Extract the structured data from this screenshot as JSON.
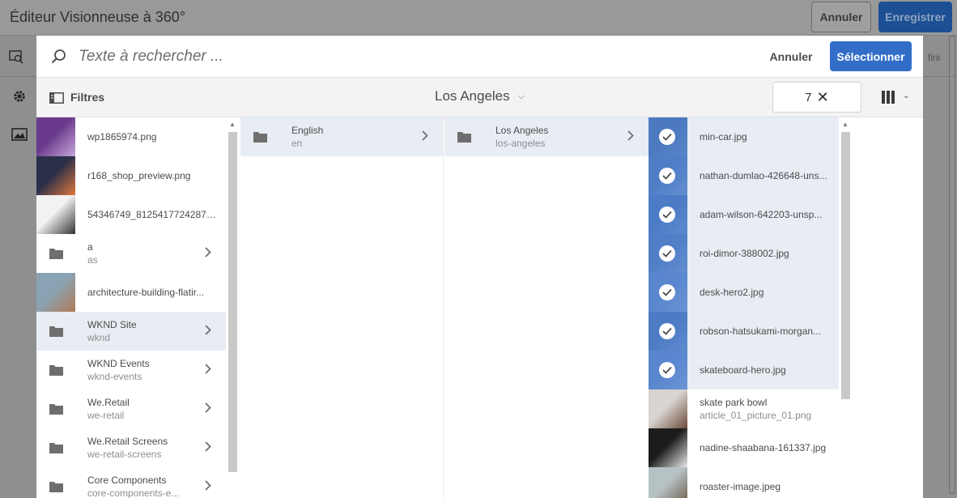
{
  "background": {
    "title": "Éditeur Visionneuse à 360°",
    "cancel_label": "Annuler",
    "save_label": "Enregistrer",
    "partial_text": "fini"
  },
  "search": {
    "placeholder": "Texte à rechercher ...",
    "value": ""
  },
  "modal": {
    "cancel_label": "Annuler",
    "select_label": "Sélectionner"
  },
  "toolbar": {
    "filters_label": "Filtres",
    "breadcrumb": "Los Angeles",
    "selection_count": "7"
  },
  "column1": [
    {
      "name": "wp1865974.png",
      "type": "image",
      "colors": [
        "#6a3a8c",
        "#c7a8d8"
      ]
    },
    {
      "name": "r168_shop_preview.png",
      "type": "image",
      "colors": [
        "#2a2f4a",
        "#e07a3c"
      ]
    },
    {
      "name": "54346749_812541772428718_...",
      "type": "image",
      "colors": [
        "#f2f2f2",
        "#333333"
      ]
    },
    {
      "name": "a",
      "sub": "as",
      "type": "folder"
    },
    {
      "name": "architecture-building-flatir...",
      "type": "image",
      "colors": [
        "#8aa3b4",
        "#b07a55"
      ]
    },
    {
      "name": "WKND Site",
      "sub": "wknd",
      "type": "folder",
      "selected": true
    },
    {
      "name": "WKND Events",
      "sub": "wknd-events",
      "type": "folder"
    },
    {
      "name": "We.Retail",
      "sub": "we-retail",
      "type": "folder"
    },
    {
      "name": "We.Retail Screens",
      "sub": "we-retail-screens",
      "type": "folder"
    },
    {
      "name": "Core Components",
      "sub": "core-components-e...",
      "type": "folder"
    }
  ],
  "column2": [
    {
      "name": "English",
      "sub": "en",
      "type": "folder",
      "selected": true
    }
  ],
  "column3": [
    {
      "name": "Los Angeles",
      "sub": "los-angeles",
      "type": "folder",
      "selected": true
    }
  ],
  "column4": [
    {
      "name": "min-car.jpg",
      "checked": true,
      "colors": [
        "#4d6d9a",
        "#7a94bd"
      ]
    },
    {
      "name": "nathan-dumlao-426648-uns...",
      "checked": true,
      "colors": [
        "#5c7fb5",
        "#9fb6d6"
      ]
    },
    {
      "name": "adam-wilson-642203-unsp...",
      "checked": true,
      "colors": [
        "#4d75b2",
        "#8aa6cf"
      ]
    },
    {
      "name": "roi-dimor-388002.jpg",
      "checked": true,
      "colors": [
        "#5a80b9",
        "#a2b7d4"
      ]
    },
    {
      "name": "desk-hero2.jpg",
      "checked": true,
      "colors": [
        "#7a9ad0",
        "#b9c9e2"
      ]
    },
    {
      "name": "robson-hatsukami-morgan...",
      "checked": true,
      "colors": [
        "#4f73ad",
        "#90a9cf"
      ]
    },
    {
      "name": "skateboard-hero.jpg",
      "checked": true,
      "colors": [
        "#7b9bd1",
        "#c2d0e6"
      ]
    },
    {
      "name": "skate park bowl",
      "sub": "article_01_picture_01.png",
      "checked": false,
      "colors": [
        "#d9d4cf",
        "#6b4a3a"
      ]
    },
    {
      "name": "nadine-shaabana-161337.jpg",
      "checked": false,
      "colors": [
        "#1c1c1c",
        "#e8e8e8"
      ]
    },
    {
      "name": "roaster-image.jpeg",
      "checked": false,
      "colors": [
        "#b6c2c4",
        "#6a5644"
      ]
    }
  ],
  "colors": {
    "accent": "#326ec8",
    "selected_row": "#e8edf4",
    "check_overlay": "#4c7ecd"
  }
}
